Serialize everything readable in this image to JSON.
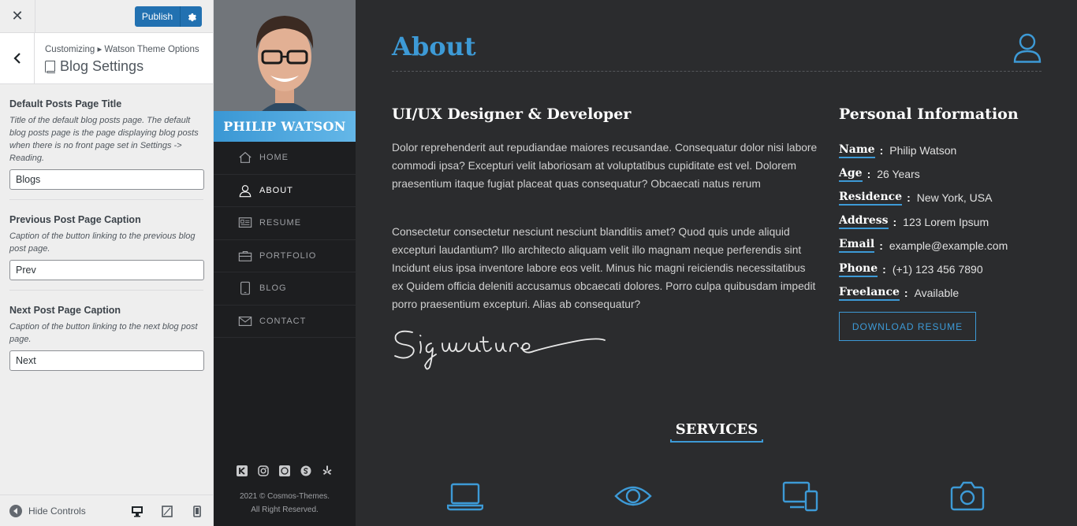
{
  "customizer": {
    "publish_label": "Publish",
    "breadcrumb": "Customizing ▸ Watson Theme Options",
    "section_title": "Blog Settings",
    "controls": [
      {
        "label": "Default Posts Page Title",
        "description": "Title of the default blog posts page. The default blog posts page is the page displaying blog posts when there is no front page set in Settings -> Reading.",
        "value": "Blogs"
      },
      {
        "label": "Previous Post Page Caption",
        "description": "Caption of the button linking to the previous blog post page.",
        "value": "Prev"
      },
      {
        "label": "Next Post Page Caption",
        "description": "Caption of the button linking to the next blog post page.",
        "value": "Next"
      }
    ],
    "hide_controls_label": "Hide Controls",
    "devices": [
      "desktop-icon",
      "tablet-icon",
      "mobile-icon"
    ]
  },
  "sidebar": {
    "name": "PHILIP WATSON",
    "menu": [
      {
        "label": "HOME",
        "icon": "home-icon"
      },
      {
        "label": "ABOUT",
        "icon": "user-icon",
        "active": true
      },
      {
        "label": "RESUME",
        "icon": "resume-icon"
      },
      {
        "label": "PORTFOLIO",
        "icon": "briefcase-icon"
      },
      {
        "label": "BLOG",
        "icon": "tablet-icon"
      },
      {
        "label": "CONTACT",
        "icon": "envelope-icon"
      }
    ],
    "socials": [
      "klout-icon",
      "instagram-icon",
      "whatsapp-icon",
      "skype-icon",
      "yelp-icon"
    ],
    "copyright_line1": "2021 © Cosmos-Themes.",
    "copyright_line2": "All Right Reserved."
  },
  "about": {
    "title": "About",
    "subtitle": "UI/UX Designer & Developer",
    "paragraph1": "Dolor reprehenderit aut repudiandae maiores recusandae. Consequatur dolor nisi labore commodi ipsa? Excepturi velit laboriosam at voluptatibus cupiditate est vel. Dolorem praesentium itaque fugiat placeat quas consequatur? Obcaecati natus rerum",
    "paragraph2": "Consectetur consectetur nesciunt nesciunt blanditiis amet? Quod quis unde aliquid excepturi laudantium? Illo architecto aliquam velit illo magnam neque perferendis sint Incidunt eius ipsa inventore labore eos velit. Minus hic magni reiciendis necessitatibus ex Quidem officia deleniti accusamus obcaecati dolores. Porro culpa quibusdam impedit porro praesentium excepturi. Alias ab consequatur?",
    "personal_title": "Personal Information",
    "info": [
      {
        "key": "Name",
        "value": "Philip Watson"
      },
      {
        "key": "Age",
        "value": "26 Years"
      },
      {
        "key": "Residence",
        "value": "New York, USA"
      },
      {
        "key": "Address",
        "value": "123 Lorem Ipsum"
      },
      {
        "key": "Email",
        "value": "example@example.com"
      },
      {
        "key": "Phone",
        "value": "(+1) 123 456 7890"
      },
      {
        "key": "Freelance",
        "value": "Available"
      }
    ],
    "download_label": "DOWNLOAD RESUME",
    "services_title": "SERVICES",
    "service_icons": [
      "laptop-icon",
      "eye-icon",
      "devices-icon",
      "camera-icon"
    ]
  },
  "colors": {
    "accent": "#3d9ad6",
    "wp_blue": "#2271b1",
    "main_bg": "#2b2c2e",
    "sidebar_bg": "#1d1e20"
  }
}
